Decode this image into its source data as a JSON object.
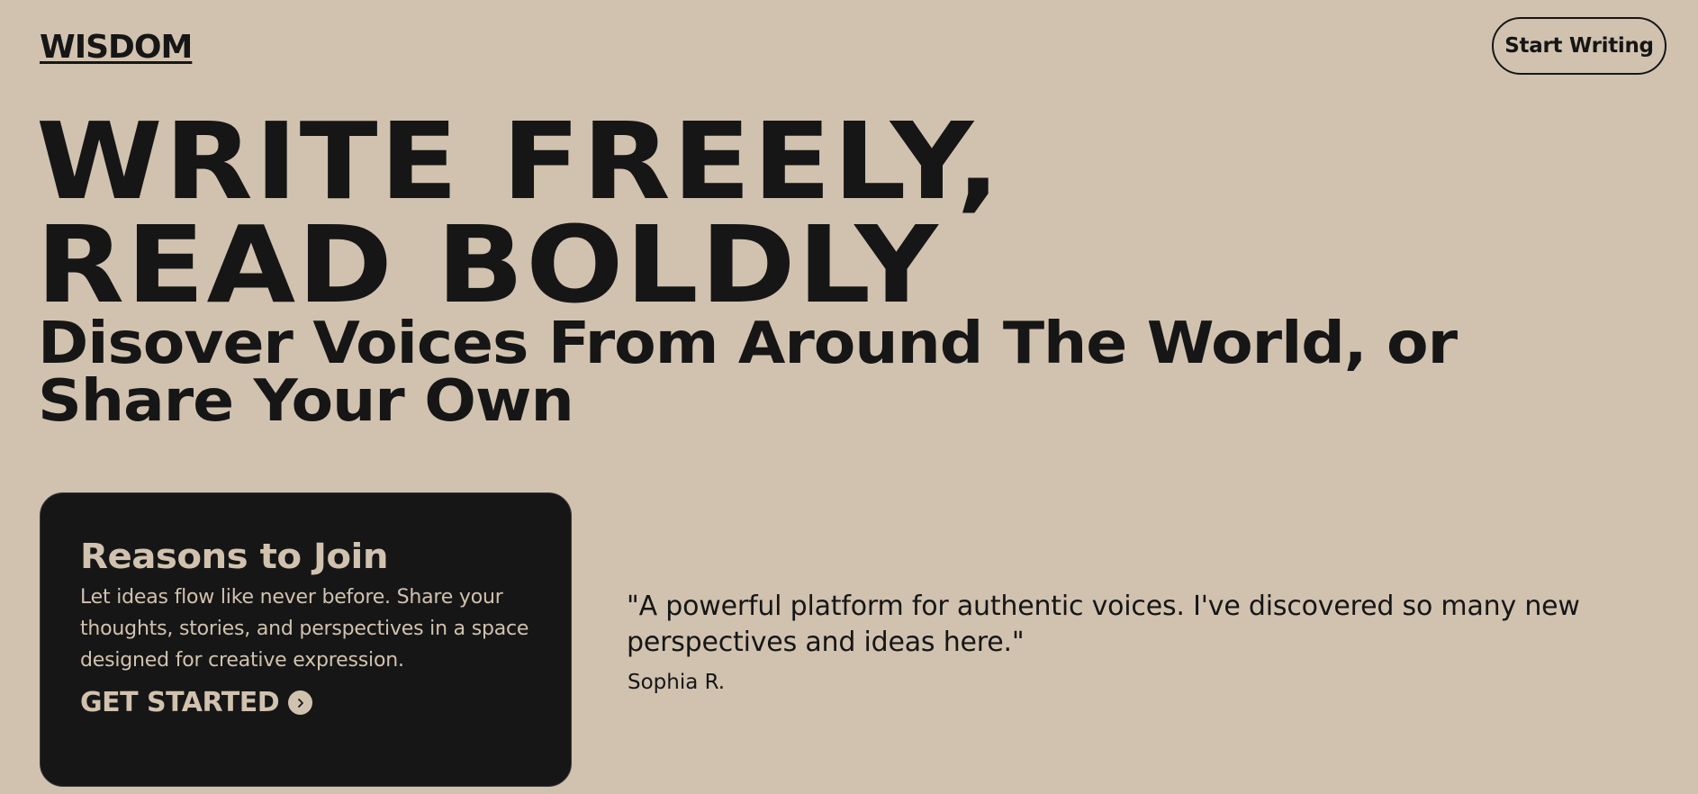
{
  "header": {
    "logo": "WISDOM",
    "cta_label": "Start Writing"
  },
  "hero": {
    "title_line1": "WRITE FREELY,",
    "title_line2": "READ BOLDLY",
    "subtitle": "Disover Voices From Around The World, or Share Your Own"
  },
  "card": {
    "title": "Reasons to Join",
    "text": "Let ideas flow like never before. Share your thoughts, stories, and perspectives in a space designed for creative expression.",
    "link_label": "GET STARTED",
    "link_icon": "chevron-right-icon"
  },
  "testimonial": {
    "quote": "\"A powerful platform for authentic voices. I've discovered so many new perspectives and ideas here.\"",
    "author": "Sophia R."
  },
  "colors": {
    "background": "#d1c2af",
    "ink": "#161616"
  }
}
